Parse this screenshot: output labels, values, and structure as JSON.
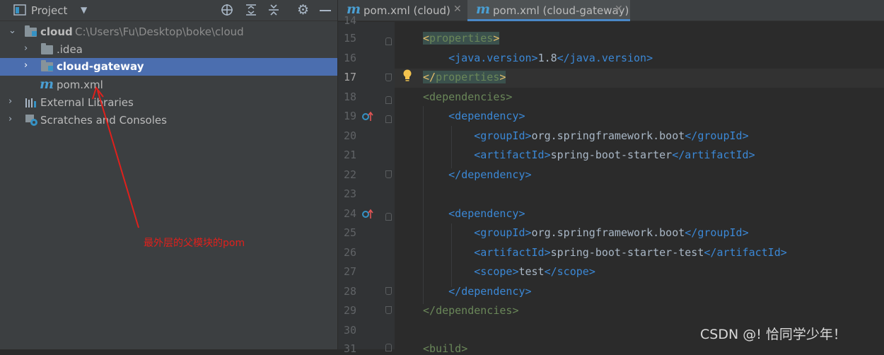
{
  "project_panel": {
    "title": "Project",
    "tree": [
      {
        "label": "cloud",
        "path": "C:\\Users\\Fu\\Desktop\\boke\\cloud"
      },
      {
        "label": ".idea"
      },
      {
        "label": "cloud-gateway"
      },
      {
        "label": "pom.xml"
      },
      {
        "label": "External Libraries"
      },
      {
        "label": "Scratches and Consoles"
      }
    ]
  },
  "editor": {
    "tabs": [
      {
        "label": "pom.xml (cloud)",
        "active": false
      },
      {
        "label": "pom.xml (cloud-gateway)",
        "active": true
      }
    ],
    "current_line": 17,
    "line_numbers": [
      "14",
      "15",
      "16",
      "17",
      "18",
      "19",
      "20",
      "21",
      "22",
      "23",
      "24",
      "25",
      "26",
      "27",
      "28",
      "29",
      "30",
      "31"
    ],
    "lines": {
      "l15": "properties",
      "l16_tag": "java.version",
      "l16_val": "1.8",
      "l17": "properties",
      "l18": "dependencies",
      "l19": "dependency",
      "l20_tag": "groupId",
      "l20_val": "org.springframework.boot",
      "l21_tag": "artifactId",
      "l21_val": "spring-boot-starter",
      "l22": "dependency",
      "l24": "dependency",
      "l25_tag": "groupId",
      "l25_val": "org.springframework.boot",
      "l26_tag": "artifactId",
      "l26_val": "spring-boot-starter-test",
      "l27_tag": "scope",
      "l27_val": "test",
      "l28": "dependency",
      "l29": "dependencies",
      "l31": "build"
    }
  },
  "annotation": {
    "text": "最外层的父模块的pom",
    "color": "#e0201c"
  },
  "watermark": "CSDN @! 恰同学少年！",
  "colors": {
    "selection": "#4b6eaf",
    "tag": "#e8bf6a",
    "tag_name": "#3b88d6",
    "maven_icon": "#4a9fd3"
  }
}
